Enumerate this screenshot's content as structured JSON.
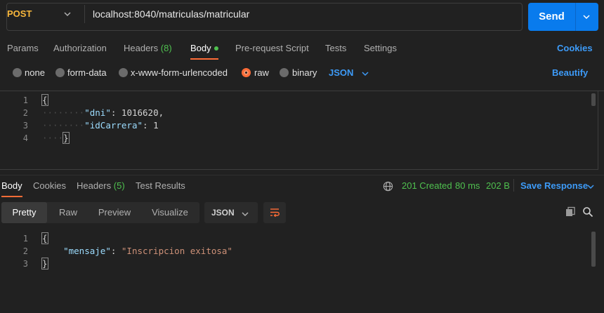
{
  "request": {
    "method": "POST",
    "url": "localhost:8040/matriculas/matricular",
    "send_label": "Send"
  },
  "request_tabs": {
    "params": "Params",
    "authorization": "Authorization",
    "headers": "Headers",
    "headers_count": "(8)",
    "body": "Body",
    "prerequest": "Pre-request Script",
    "tests": "Tests",
    "settings": "Settings",
    "cookies": "Cookies"
  },
  "body_types": {
    "none": "none",
    "form_data": "form-data",
    "urlencoded": "x-www-form-urlencoded",
    "raw": "raw",
    "binary": "binary",
    "format": "JSON",
    "beautify": "Beautify",
    "selected": "raw"
  },
  "request_editor": {
    "line_numbers": [
      "1",
      "2",
      "3",
      "4"
    ],
    "open_brace": "{",
    "close_brace": "}",
    "key1": "\"dni\"",
    "val1": "1016620",
    "key2": "\"idCarrera\"",
    "val2": "1"
  },
  "response_tabs": {
    "body": "Body",
    "cookies": "Cookies",
    "headers": "Headers",
    "headers_count": "(5)",
    "test_results": "Test Results"
  },
  "response_meta": {
    "status": "201 Created",
    "time": "80 ms",
    "size": "202 B",
    "save": "Save Response"
  },
  "view_modes": {
    "pretty": "Pretty",
    "raw": "Raw",
    "preview": "Preview",
    "visualize": "Visualize",
    "format": "JSON"
  },
  "response_editor": {
    "line_numbers": [
      "1",
      "2",
      "3"
    ],
    "open_brace": "{",
    "close_brace": "}",
    "key": "\"mensaje\"",
    "value": "\"Inscripcion exitosa\""
  },
  "colors": {
    "accent": "#ff6c37",
    "primary": "#097bed",
    "link": "#3d9bf8",
    "success": "#4fc04f",
    "method_post": "#f8b73c"
  }
}
